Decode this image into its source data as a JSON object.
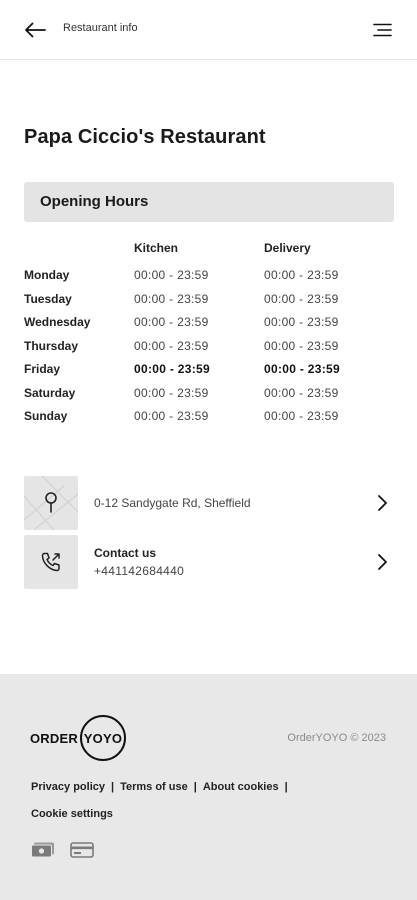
{
  "header": {
    "title": "Restaurant info",
    "back_icon": "arrow-left-icon",
    "menu_icon": "hamburger-menu-icon"
  },
  "restaurant": {
    "name": "Papa Ciccio's Restaurant"
  },
  "opening_hours": {
    "section_title": "Opening Hours",
    "columns": [
      "Kitchen",
      "Delivery"
    ],
    "rows": [
      {
        "day": "Monday",
        "kitchen": "00:00 - 23:59",
        "delivery": "00:00 - 23:59"
      },
      {
        "day": "Tuesday",
        "kitchen": "00:00 - 23:59",
        "delivery": "00:00 - 23:59"
      },
      {
        "day": "Wednesday",
        "kitchen": "00:00 - 23:59",
        "delivery": "00:00 - 23:59"
      },
      {
        "day": "Thursday",
        "kitchen": "00:00 - 23:59",
        "delivery": "00:00 - 23:59"
      },
      {
        "day": "Friday",
        "kitchen": "00:00 - 23:59",
        "delivery": "00:00 - 23:59"
      },
      {
        "day": "Saturday",
        "kitchen": "00:00 - 23:59",
        "delivery": "00:00 - 23:59"
      },
      {
        "day": "Sunday",
        "kitchen": "00:00 - 23:59",
        "delivery": "00:00 - 23:59"
      }
    ]
  },
  "address": {
    "text": "0-12 Sandygate Rd, Sheffield",
    "icon": "map-pin-icon"
  },
  "contact": {
    "label": "Contact us",
    "phone": "+441142684440",
    "icon": "phone-call-icon"
  },
  "footer": {
    "logo_left": "ORDER",
    "logo_right": "YOYO",
    "copyright": "OrderYOYO © 2023",
    "links": [
      "Privacy policy",
      "Terms of use",
      "About cookies"
    ],
    "cookie_settings": "Cookie settings",
    "payment_icons": [
      "cash-icon",
      "credit-card-icon"
    ]
  },
  "colors": {
    "section_bar": "#e4e4e4",
    "footer_bg": "#e8e8e8",
    "thumb_bg": "#e5e5e5",
    "text": "#1a1a1a"
  }
}
